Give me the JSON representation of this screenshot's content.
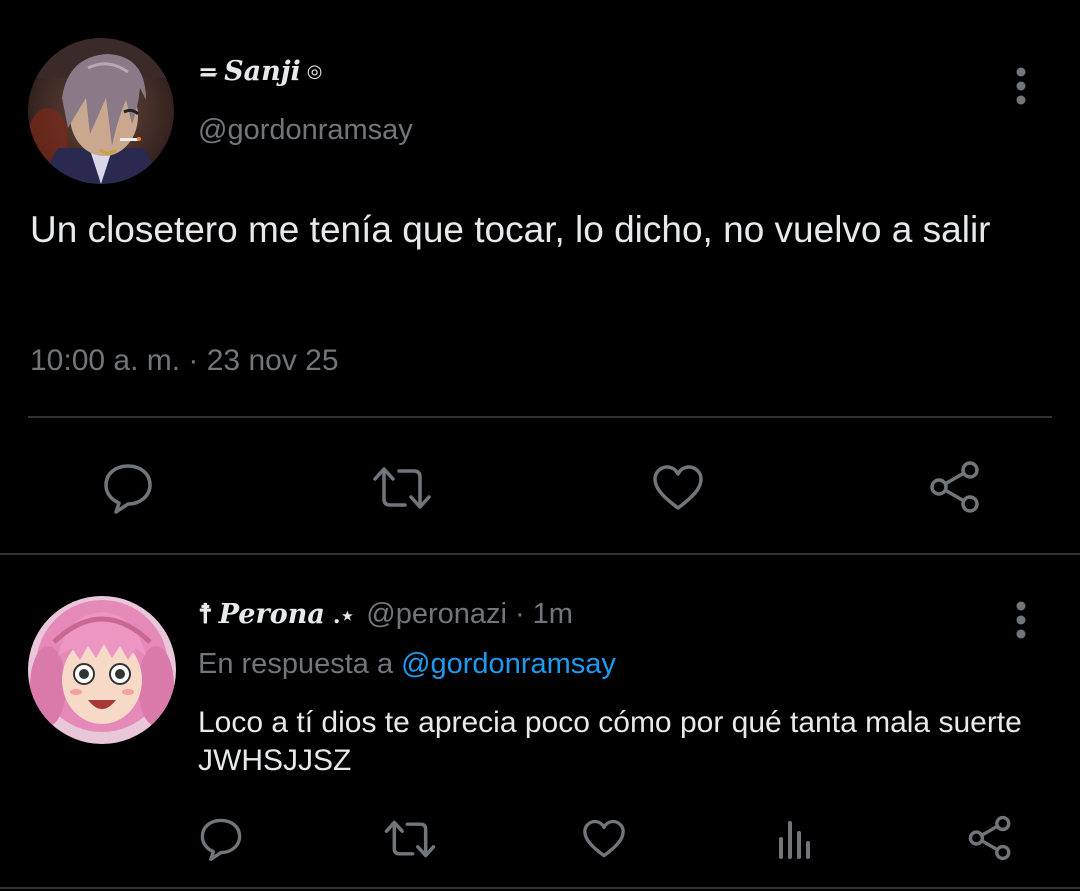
{
  "main_tweet": {
    "avatar": "avatar-sanji",
    "display_name": {
      "prefix": "=̶",
      "name": "Sanji",
      "suffix": "◎"
    },
    "handle": "@gordonramsay",
    "text": "Un closetero me tenía que tocar, lo dicho, no vuelvo a salir",
    "timestamp": "10:00 a. m. · 23 nov 25",
    "more_icon": "more-vertical-icon",
    "actions": [
      "reply-icon",
      "retweet-icon",
      "like-icon",
      "share-icon"
    ]
  },
  "reply_tweet": {
    "avatar": "avatar-perona",
    "display_name": {
      "prefix": "☨",
      "name": "Perona",
      "suffix": ".⋆"
    },
    "handle": "@peronazi",
    "separator": "·",
    "time": "1m",
    "reply_to_label": "En respuesta a",
    "reply_to_handle": "@gordonramsay",
    "text": "Loco a tí dios te aprecia poco cómo por qué tanta mala suerte JWHSJJSZ",
    "more_icon": "more-vertical-icon",
    "actions": [
      "reply-icon",
      "retweet-icon",
      "like-icon",
      "stats-icon",
      "share-icon"
    ]
  },
  "colors": {
    "background": "#000000",
    "text_primary": "#e7e9ea",
    "text_secondary": "#71767b",
    "link": "#1d9bf0",
    "divider": "#2f3336"
  }
}
